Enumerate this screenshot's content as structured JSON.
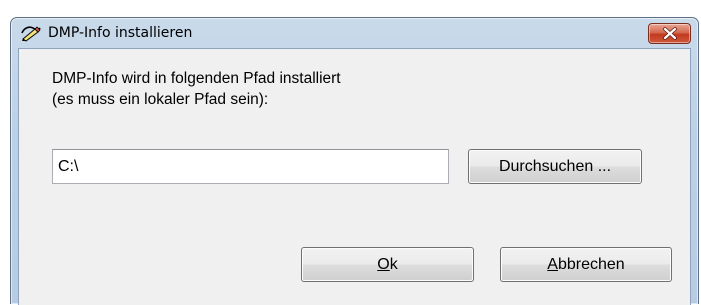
{
  "window": {
    "title": "DMP-Info installieren",
    "app_icon": "pen-icon",
    "close_icon": "close-icon"
  },
  "dialog": {
    "description_line1": "DMP-Info wird in folgenden Pfad installiert",
    "description_line2": "(es muss ein lokaler Pfad sein):",
    "path_value": "C:\\",
    "browse_label": "Durchsuchen ...",
    "ok_accel": "O",
    "ok_rest": "k",
    "cancel_accel": "A",
    "cancel_rest": "bbrechen"
  },
  "colors": {
    "close_button": "#c2391f",
    "titlebar": "#c9daea",
    "client_background": "#f0f0f0"
  }
}
